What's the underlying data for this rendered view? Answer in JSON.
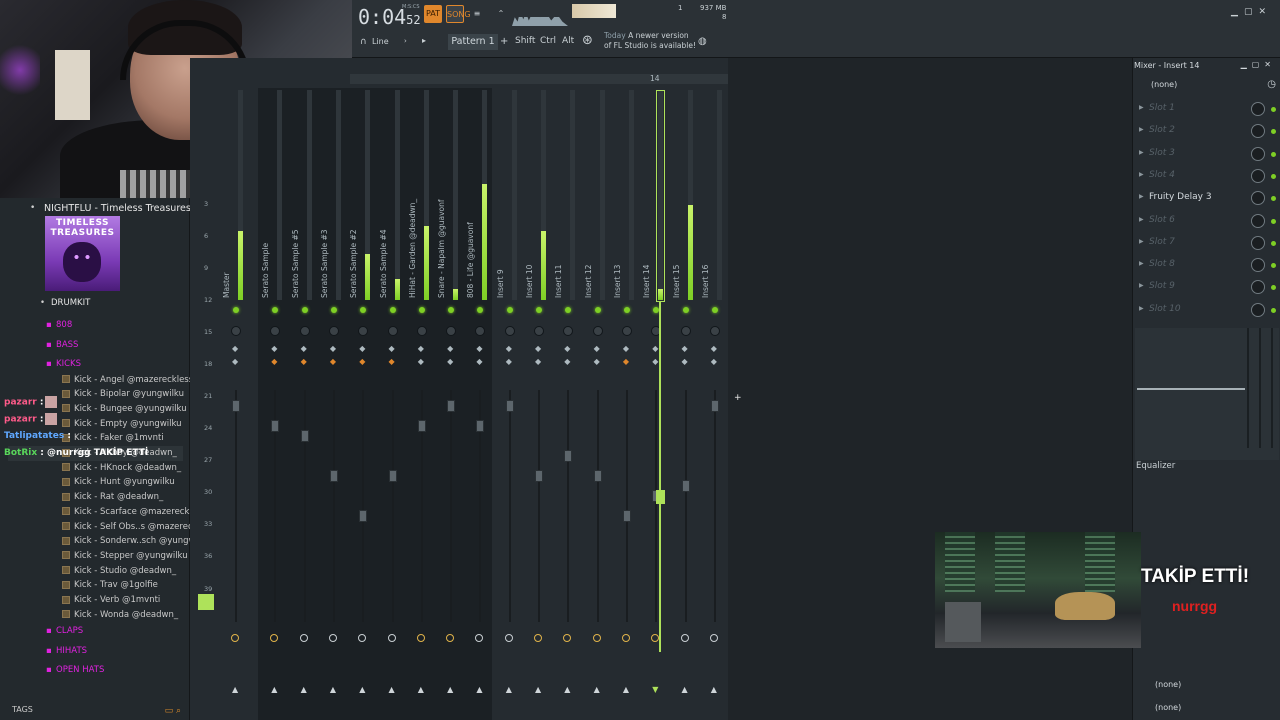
{
  "toolbar": {
    "time": "0:04",
    "time_small": "52",
    "time_unit": "M:S:CS",
    "pat_label": "PAT",
    "song_label": "SONG",
    "snap_label": "Line",
    "pattern_label": "Pattern 1",
    "add_label": "+",
    "shift_label": "Shift",
    "ctrl_label": "Ctrl",
    "alt_label": "Alt",
    "news_today": "Today",
    "news_text": "A newer version of FL Studio is available!",
    "cpu_num": "1",
    "mem": "937 MB",
    "poly": "8"
  },
  "browser": {
    "now_playing": "NIGHTFLU - Timeless Treasures",
    "album_text": "TIMELESS TREASURES",
    "drumkit": "DRUMKIT",
    "folders_top": [
      "808",
      "BASS",
      "KICKS"
    ],
    "kicks": [
      "Kick - Angel @mazereckless",
      "Kick - Bipolar @yungwilku",
      "Kick - Bungee @yungwilku",
      "Kick - Empty @yungwilku",
      "Kick - Faker @1mvnti",
      "Kick - Hitboy @deadwn_",
      "Kick - HKnock @deadwn_",
      "Kick - Hunt @yungwilku",
      "Kick - Rat @deadwn_",
      "Kick - Scarface @mazereckless",
      "Kick - Self Obs..s @mazereckless",
      "Kick - Sonderw..sch @yungwilku",
      "Kick - Stepper @yungwilku",
      "Kick - Studio @deadwn_",
      "Kick - Trav @1golfie",
      "Kick - Verb @1mvnti",
      "Kick - Wonda @deadwn_"
    ],
    "folders_bottom": [
      "CLAPS",
      "HIHATS",
      "OPEN HATS"
    ],
    "tags_label": "TAGS"
  },
  "chat": [
    {
      "user": "pazarr",
      "text": ":",
      "color": "#ff5b8a"
    },
    {
      "user": "pazarr",
      "text": ":",
      "color": "#ff5b8a"
    },
    {
      "user": "Tatlipatates",
      "text": ":",
      "color": "#5fa8ff"
    },
    {
      "user": "BotRix",
      "text": ": @nurrgg TAKİP ETTİ",
      "color": "#59d65a"
    }
  ],
  "mixer": {
    "ruler_numbers": [
      "14"
    ],
    "scale_numbers": [
      "3",
      "6",
      "9",
      "12",
      "15",
      "18",
      "21",
      "24",
      "27",
      "30",
      "33",
      "36",
      "39"
    ],
    "strips": [
      {
        "name": "Master",
        "meter": 0.33,
        "grp": false
      },
      {
        "name": "Serato Sample",
        "meter": 0.0,
        "grp": true
      },
      {
        "name": "Serato Sample #5",
        "meter": 0.0,
        "grp": true
      },
      {
        "name": "Serato Sample #3",
        "meter": 0.0,
        "grp": true
      },
      {
        "name": "Serato Sample #2",
        "meter": 0.22,
        "grp": true
      },
      {
        "name": "Serato Sample #4",
        "meter": 0.1,
        "grp": true
      },
      {
        "name": "HiHat - Garden @deadwn_",
        "meter": 0.35,
        "grp": true
      },
      {
        "name": "Snare - Napalm @guavonf",
        "meter": 0.05,
        "grp": true
      },
      {
        "name": "808 - Life @guavonf",
        "meter": 0.55,
        "grp": true
      },
      {
        "name": "Insert 9",
        "meter": 0.0,
        "grp": false
      },
      {
        "name": "Insert 10",
        "meter": 0.33,
        "grp": false
      },
      {
        "name": "Insert 11",
        "meter": 0.0,
        "grp": false
      },
      {
        "name": "Insert 12",
        "meter": 0.0,
        "grp": false
      },
      {
        "name": "Insert 13",
        "meter": 0.0,
        "grp": false
      },
      {
        "name": "Insert 14",
        "meter": 0.05,
        "grp": false
      },
      {
        "name": "Insert 15",
        "meter": 0.45,
        "grp": false
      },
      {
        "name": "Insert 16",
        "meter": 0.0,
        "grp": false
      }
    ]
  },
  "insert_panel": {
    "title": "Mixer - Insert 14",
    "preset": "(none)",
    "slots": [
      "Slot 1",
      "Slot 2",
      "Slot 3",
      "Slot 4",
      "Fruity Delay 3",
      "Slot 6",
      "Slot 7",
      "Slot 8",
      "Slot 9",
      "Slot 10"
    ],
    "equalizer_label": "Equalizer",
    "out1": "(none)",
    "out2": "(none)"
  },
  "alert": {
    "title": "TAKİP ETTİ!",
    "user": "nurrgg"
  },
  "colors": {
    "accent_orange": "#e0872c",
    "meter_green": "#7ecf25",
    "folder_magenta": "#e022e0",
    "alert_red": "#e02020"
  }
}
